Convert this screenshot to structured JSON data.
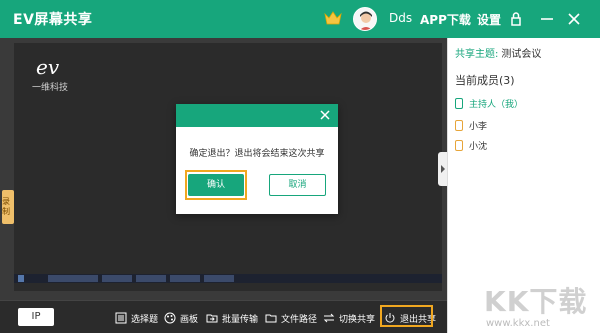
{
  "titlebar": {
    "app_title": "EV屏幕共享",
    "username": "Dds",
    "app_download": "APP下载",
    "settings": "设置"
  },
  "icons": {
    "crown": "crown-icon",
    "avatar": "avatar",
    "lock": "lock-icon",
    "minimize": "minimize-icon",
    "close": "close-icon"
  },
  "screen": {
    "brand_logo": "ev",
    "brand_sub": "一维科技"
  },
  "side_tab": {
    "label": "录制"
  },
  "toolbar": {
    "ip": "IP",
    "items": [
      {
        "label": "选择题",
        "icon": "list-icon"
      },
      {
        "label": "画板",
        "icon": "palette-icon"
      },
      {
        "label": "批量传输",
        "icon": "folder-transfer-icon"
      },
      {
        "label": "文件路径",
        "icon": "folder-icon"
      },
      {
        "label": "切换共享",
        "icon": "swap-icon"
      },
      {
        "label": "退出共享",
        "icon": "power-icon"
      }
    ]
  },
  "right_panel": {
    "topic_label": "共享主题:",
    "topic_value": "测试会议",
    "members_title": "当前成员(3)",
    "members": [
      {
        "name": "主持人（我）",
        "host": true
      },
      {
        "name": "小李",
        "host": false
      },
      {
        "name": "小沈",
        "host": false
      }
    ]
  },
  "modal": {
    "message": "确定退出？退出将会结束这次共享",
    "confirm": "确认",
    "cancel": "取消"
  },
  "watermark": {
    "big": "KK下载",
    "small": "www.kkx.net"
  },
  "colors": {
    "brand_green": "#17a67c",
    "highlight_orange": "#f0a720",
    "dark_bg": "#3a3a3a"
  }
}
